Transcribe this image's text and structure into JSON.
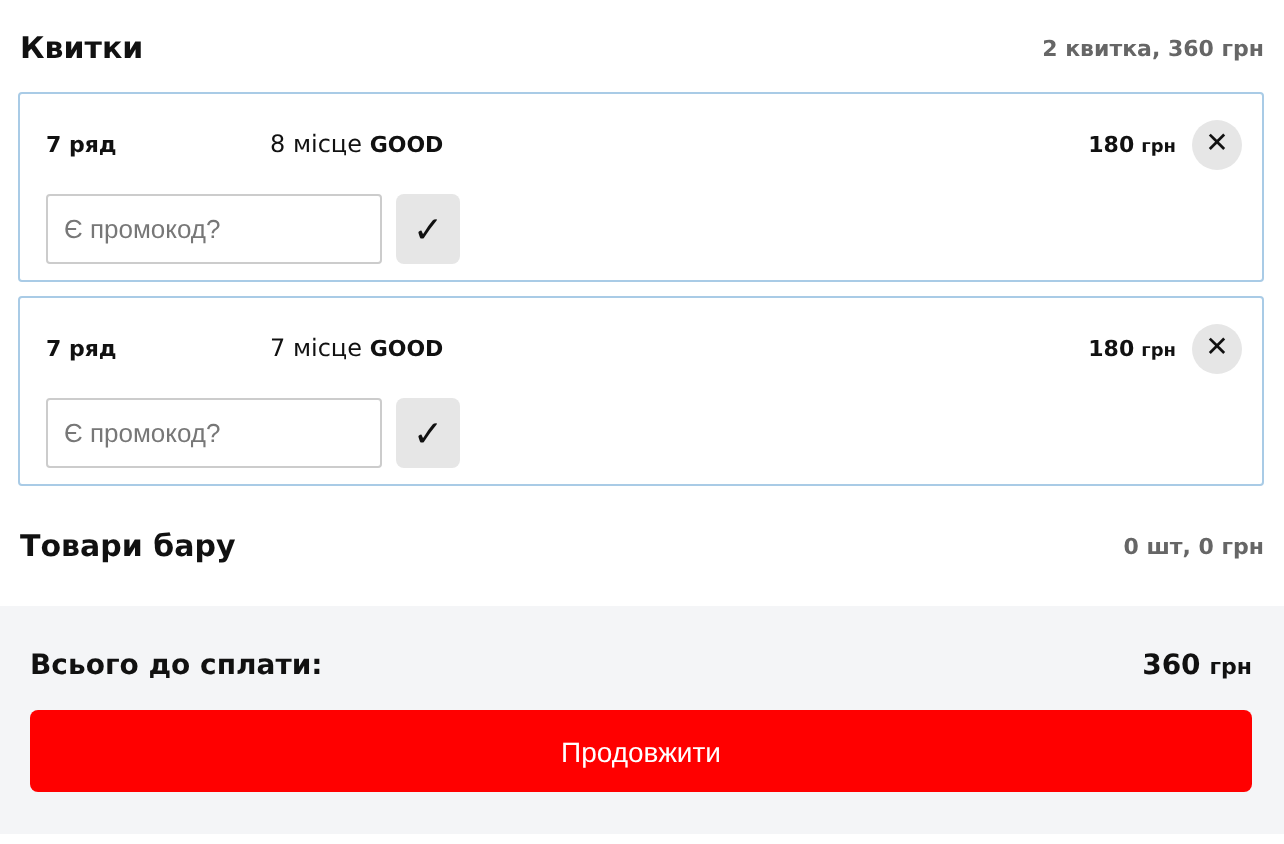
{
  "tickets": {
    "title": "Квитки",
    "summary": "2 квитка, 360 грн",
    "items": [
      {
        "row": "7 ряд",
        "seat": "8 місце **GOOD**",
        "amount": "180",
        "currency": "грн",
        "promo_placeholder": "Є промокод?",
        "apply": "✓",
        "remove": "✕"
      },
      {
        "row": "7 ряд",
        "seat": "7 місце **GOOD**",
        "amount": "180",
        "currency": "грн",
        "promo_placeholder": "Є промокод?",
        "apply": "✓",
        "remove": "✕"
      }
    ]
  },
  "bar": {
    "title": "Товари бару",
    "summary": "0 шт, 0 грн"
  },
  "total": {
    "label": "Всього до сплати:",
    "amount": "360",
    "currency": "грн"
  },
  "continue_button": "Продовжити"
}
